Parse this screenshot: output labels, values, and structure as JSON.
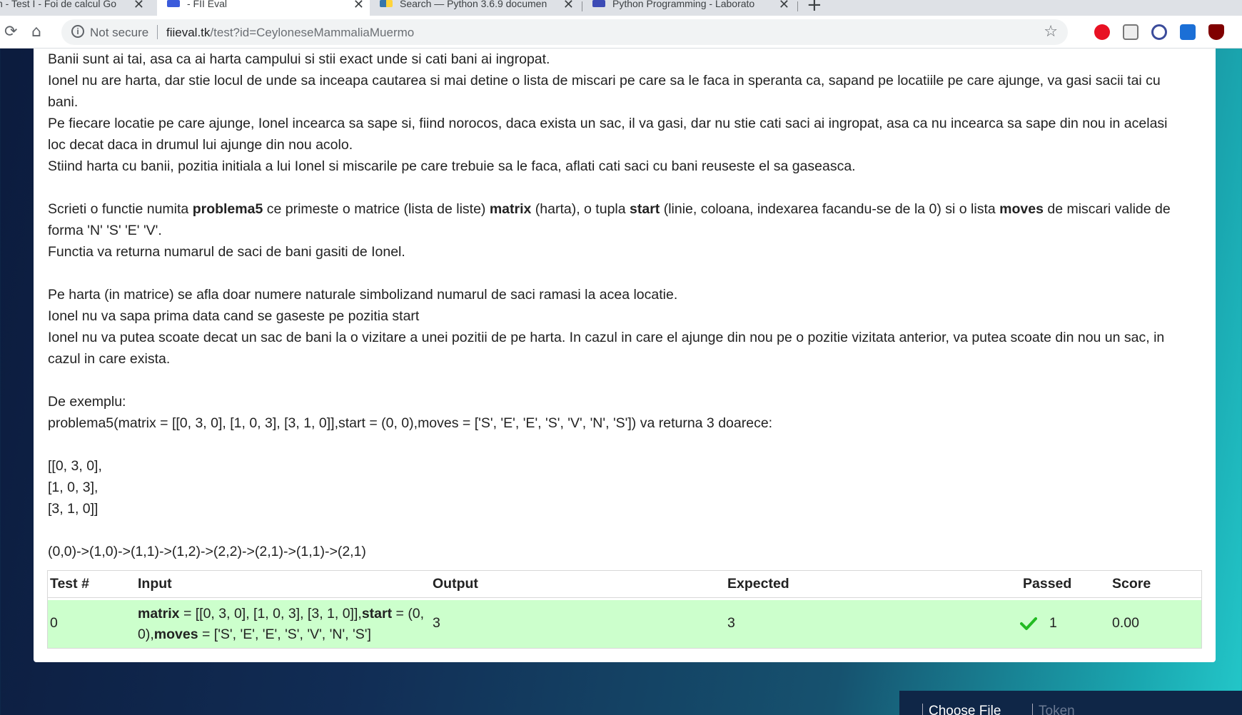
{
  "browser": {
    "tabs": [
      {
        "title": "n - Test I - Foi de calcul Go",
        "active": false
      },
      {
        "title": "- FII Eval",
        "active": true
      },
      {
        "title": "Search — Python 3.6.9 documen",
        "active": false
      },
      {
        "title": "Python Programming - Laborato",
        "active": false
      }
    ],
    "new_tab_label": "+",
    "close_glyph": "✕",
    "security_text": "Not secure",
    "url_host": "fiieval.tk",
    "url_path": "/test?id=CeyloneseMammaliaMuermo"
  },
  "problem": {
    "intro_1": "Banii sunt ai tai, asa ca ai harta campului si stii exact unde si cati bani ai ingropat.",
    "intro_2a": "Ionel nu are harta, dar stie locul de unde sa inceapa cautarea si mai detine o lista de miscari pe care sa le faca in speranta ca, sapand pe locatiile pe care ajunge, va gasi sacii tai cu",
    "intro_2b": "bani.",
    "intro_3a": "Pe fiecare locatie pe care ajunge, Ionel incearca sa sape si, fiind norocos, daca exista un sac, il va gasi, dar nu stie cati saci ai ingropat, asa ca nu incearca sa sape din nou in acelasi",
    "intro_3b": "loc decat daca in drumul lui ajunge din nou acolo.",
    "intro_4": "Stiind harta cu banii, pozitia initiala a lui Ionel si miscarile pe care trebuie sa le faca, aflati cati saci cu bani reuseste el sa gaseasca.",
    "task_1": "Scrieti o functie numita ",
    "func_name": "problema5",
    "task_2": " ce primeste o matrice (lista de liste) ",
    "arg_matrix": "matrix",
    "task_3": " (harta), o tupla ",
    "arg_start": "start",
    "task_4": " (linie, coloana, indexarea facandu-se de la 0) si o lista ",
    "arg_moves": "moves",
    "task_5": " de miscari valide de",
    "task_6": "forma 'N' 'S' 'E' 'V'.",
    "task_return": "Functia va returna numarul de saci de bani gasiti de Ionel.",
    "rule_1": "Pe harta (in matrice) se afla doar numere naturale simbolizand numarul de saci ramasi la acea locatie.",
    "rule_2": "Ionel nu va sapa prima data cand se gaseste pe pozitia start",
    "rule_3a": "Ionel nu va putea scoate decat un sac de bani la o vizitare a unei pozitii de pe harta. In cazul in care el ajunge din nou pe o pozitie vizitata anterior, va putea scoate din nou un sac, in",
    "rule_3b": "cazul in care exista.",
    "example_label": "De exemplu:",
    "example_call": "problema5(matrix = [[0, 3, 0], [1, 0, 3], [3, 1, 0]],start = (0, 0),moves = ['S', 'E', 'E', 'S', 'V', 'N', 'S']) va returna 3 doarece:",
    "matrix_row_1": "[[0, 3, 0],",
    "matrix_row_2": "[1, 0, 3],",
    "matrix_row_3": "[3, 1, 0]]",
    "path": "(0,0)->(1,0)->(1,1)->(1,2)->(2,2)->(2,1)->(1,1)->(2,1)"
  },
  "results": {
    "headers": {
      "test": "Test #",
      "input": "Input",
      "output": "Output",
      "expected": "Expected",
      "passed": "Passed",
      "score": "Score"
    },
    "rows": [
      {
        "test": "0",
        "input_matrix_label": "matrix",
        "input_matrix_value": " = [[0, 3, 0], [1, 0, 3], [3, 1, 0]],",
        "input_start_label": "start",
        "input_start_value_a": " = (0,",
        "input_start_value_b": "0),",
        "input_moves_label": "moves",
        "input_moves_value": " = ['S', 'E', 'E', 'S', 'V', 'N', 'S']",
        "output": "3",
        "expected": "3",
        "passed": "1",
        "score": "0.00"
      }
    ]
  },
  "footer": {
    "choose_file": "Choose File",
    "token_placeholder": "Token"
  },
  "colors": {
    "row_pass_bg": "#ccffcc",
    "check_green": "#22bb22"
  }
}
